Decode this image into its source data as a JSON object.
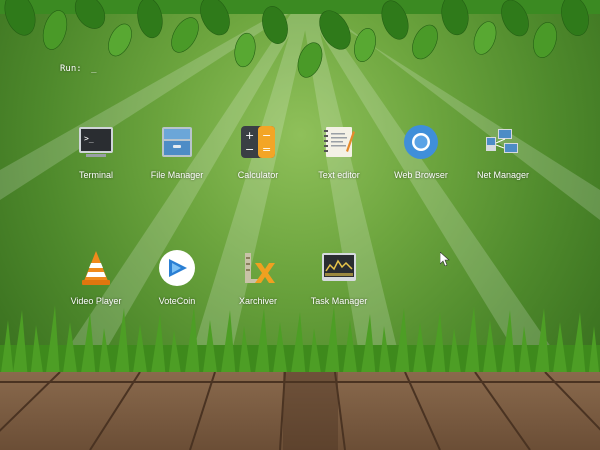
{
  "run": {
    "label": "Run:",
    "cursor": "_"
  },
  "apps": [
    {
      "label": "Terminal",
      "icon": "terminal-icon"
    },
    {
      "label": "File Manager",
      "icon": "file-manager-icon"
    },
    {
      "label": "Calculator",
      "icon": "calculator-icon"
    },
    {
      "label": "Text editor",
      "icon": "text-editor-icon"
    },
    {
      "label": "Web Browser",
      "icon": "web-browser-icon"
    },
    {
      "label": "Net Manager",
      "icon": "net-manager-icon"
    },
    {
      "label": "Video Player",
      "icon": "video-player-icon"
    },
    {
      "label": "VoteCoin",
      "icon": "votecoin-icon"
    },
    {
      "label": "Xarchiver",
      "icon": "xarchiver-icon"
    },
    {
      "label": "Task Manager",
      "icon": "task-manager-icon"
    }
  ],
  "colors": {
    "wallpaper": "#5e9a35",
    "grass": "#3f8a1f",
    "wood": "#7a5a40",
    "label": "#ffffff"
  }
}
